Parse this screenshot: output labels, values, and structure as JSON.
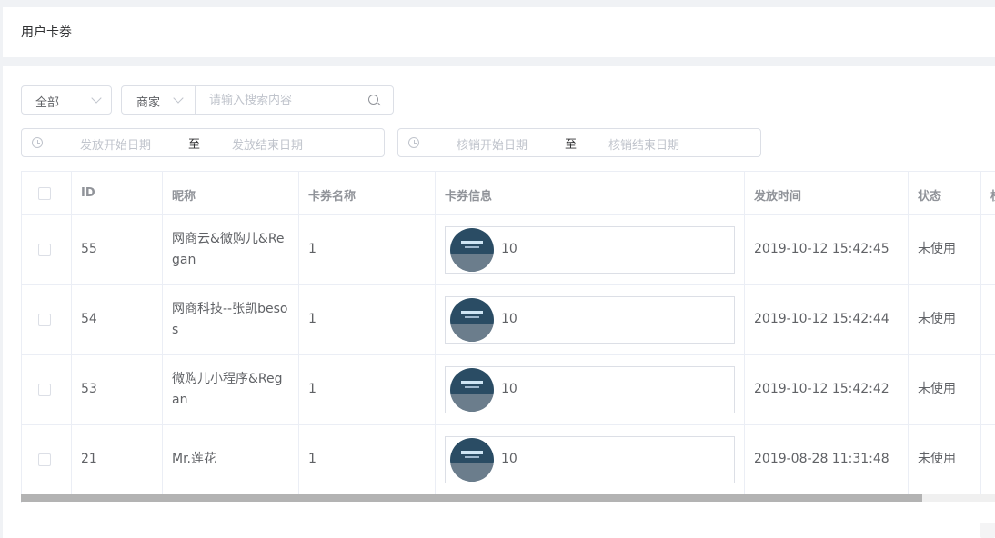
{
  "header": {
    "title": "用户卡劵"
  },
  "filters": {
    "type_select": {
      "value": "全部"
    },
    "search": {
      "field": "商家",
      "placeholder": "请输入搜索内容"
    },
    "issue_date": {
      "start_placeholder": "发放开始日期",
      "separator": "至",
      "end_placeholder": "发放结束日期"
    },
    "verify_date": {
      "start_placeholder": "核销开始日期",
      "separator": "至",
      "end_placeholder": "核销结束日期"
    }
  },
  "table": {
    "columns": [
      "ID",
      "昵称",
      "卡券名称",
      "卡券信息",
      "发放时间",
      "状态",
      "核"
    ],
    "rows": [
      {
        "id": "55",
        "nickname_l1": "网商云&微购儿&Re",
        "nickname_l2": "gan",
        "coupon_name": "1",
        "coupon_value": "10",
        "issued_at": "2019-10-12 15:42:45",
        "status": "未使用"
      },
      {
        "id": "54",
        "nickname_l1": "网商科技--张凯beso",
        "nickname_l2": "s",
        "coupon_name": "1",
        "coupon_value": "10",
        "issued_at": "2019-10-12 15:42:44",
        "status": "未使用"
      },
      {
        "id": "53",
        "nickname_l1": "微购儿小程序&Reg",
        "nickname_l2": "an",
        "coupon_name": "1",
        "coupon_value": "10",
        "issued_at": "2019-10-12 15:42:42",
        "status": "未使用"
      },
      {
        "id": "21",
        "nickname_l1": "Mr.莲花",
        "nickname_l2": "",
        "coupon_name": "1",
        "coupon_value": "10",
        "issued_at": "2019-08-28 11:31:48",
        "status": "未使用"
      }
    ]
  }
}
